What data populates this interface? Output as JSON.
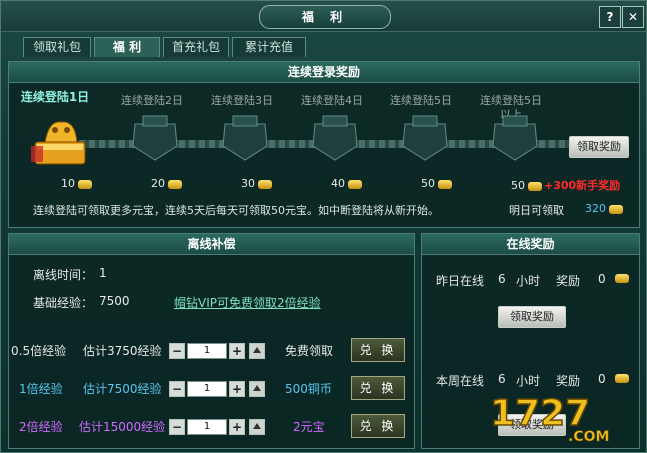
{
  "window": {
    "title": "福 利",
    "help_label": "?",
    "close_label": "✕"
  },
  "tabs": [
    {
      "label": "领取礼包",
      "active": false
    },
    {
      "label": "福  利",
      "active": true
    },
    {
      "label": "首充礼包",
      "active": false
    },
    {
      "label": "累计充值",
      "active": false
    }
  ],
  "login_reward": {
    "header": "连续登录奖励",
    "days": [
      {
        "label": "连续登陆1日",
        "reward": "10"
      },
      {
        "label": "连续登陆2日",
        "reward": "20"
      },
      {
        "label": "连续登陆3日",
        "reward": "30"
      },
      {
        "label": "连续登陆4日",
        "reward": "40"
      },
      {
        "label": "连续登陆5日",
        "reward": "50"
      },
      {
        "label": "连续登陆5日",
        "label2": "以上",
        "reward": "50"
      }
    ],
    "bonus": "+300新手奖励",
    "claim_button": "领取奖励",
    "notice": "连续登陆可领取更多元宝，连续5天后每天可领取50元宝。如中断登陆将从新开始。",
    "tomorrow_label": "明日可领取",
    "tomorrow_value": "320"
  },
  "offline": {
    "header": "离线补偿",
    "time_label": "离线时间：",
    "time_value": "1",
    "exp_label": "基础经验：",
    "exp_value": "7500",
    "vip_link": "帽钻VIP可免费领取2倍经验",
    "rows": [
      {
        "mult": "0.5倍经验",
        "est": "估计3750经验",
        "qty": "1",
        "cost": "免费领取",
        "button": "兑 换",
        "color": "#e8e8e8"
      },
      {
        "mult": "1倍经验",
        "est": "估计7500经验",
        "qty": "1",
        "cost": "500铜币",
        "button": "兑 换",
        "color": "#56c7f0"
      },
      {
        "mult": "2倍经验",
        "est": "估计15000经验",
        "qty": "1",
        "cost": "2元宝",
        "button": "兑 换",
        "color": "#d06bff"
      }
    ]
  },
  "online": {
    "header": "在线奖励",
    "yesterday": {
      "label": "昨日在线",
      "hours": "6",
      "hours_unit": "小时",
      "reward_label": "奖励",
      "reward": "0"
    },
    "week": {
      "label": "本周在线",
      "hours": "6",
      "hours_unit": "小时",
      "reward_label": "奖励",
      "reward": "0"
    },
    "claim_button": "领取奖励"
  },
  "colors": {
    "accent": "#8ff0e0",
    "bonus": "#ff2a2a",
    "gold": "#ffd23c"
  },
  "watermark": "1727.COM"
}
